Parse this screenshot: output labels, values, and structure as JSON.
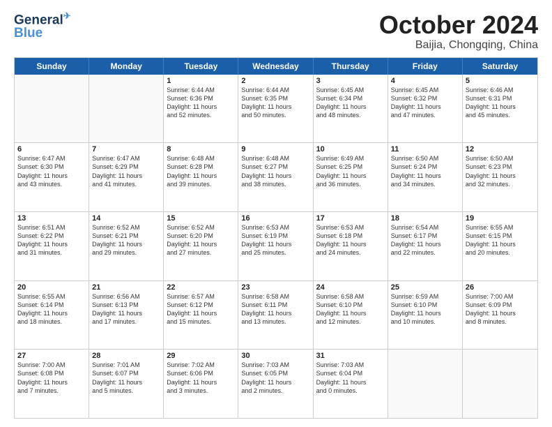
{
  "logo": {
    "line1": "General",
    "line2": "Blue"
  },
  "header": {
    "month": "October 2024",
    "location": "Baijia, Chongqing, China"
  },
  "weekdays": [
    "Sunday",
    "Monday",
    "Tuesday",
    "Wednesday",
    "Thursday",
    "Friday",
    "Saturday"
  ],
  "weeks": [
    [
      {
        "day": "",
        "info": "",
        "empty": true
      },
      {
        "day": "",
        "info": "",
        "empty": true
      },
      {
        "day": "1",
        "info": "Sunrise: 6:44 AM\nSunset: 6:36 PM\nDaylight: 11 hours\nand 52 minutes."
      },
      {
        "day": "2",
        "info": "Sunrise: 6:44 AM\nSunset: 6:35 PM\nDaylight: 11 hours\nand 50 minutes."
      },
      {
        "day": "3",
        "info": "Sunrise: 6:45 AM\nSunset: 6:34 PM\nDaylight: 11 hours\nand 48 minutes."
      },
      {
        "day": "4",
        "info": "Sunrise: 6:45 AM\nSunset: 6:32 PM\nDaylight: 11 hours\nand 47 minutes."
      },
      {
        "day": "5",
        "info": "Sunrise: 6:46 AM\nSunset: 6:31 PM\nDaylight: 11 hours\nand 45 minutes."
      }
    ],
    [
      {
        "day": "6",
        "info": "Sunrise: 6:47 AM\nSunset: 6:30 PM\nDaylight: 11 hours\nand 43 minutes."
      },
      {
        "day": "7",
        "info": "Sunrise: 6:47 AM\nSunset: 6:29 PM\nDaylight: 11 hours\nand 41 minutes."
      },
      {
        "day": "8",
        "info": "Sunrise: 6:48 AM\nSunset: 6:28 PM\nDaylight: 11 hours\nand 39 minutes."
      },
      {
        "day": "9",
        "info": "Sunrise: 6:48 AM\nSunset: 6:27 PM\nDaylight: 11 hours\nand 38 minutes."
      },
      {
        "day": "10",
        "info": "Sunrise: 6:49 AM\nSunset: 6:25 PM\nDaylight: 11 hours\nand 36 minutes."
      },
      {
        "day": "11",
        "info": "Sunrise: 6:50 AM\nSunset: 6:24 PM\nDaylight: 11 hours\nand 34 minutes."
      },
      {
        "day": "12",
        "info": "Sunrise: 6:50 AM\nSunset: 6:23 PM\nDaylight: 11 hours\nand 32 minutes."
      }
    ],
    [
      {
        "day": "13",
        "info": "Sunrise: 6:51 AM\nSunset: 6:22 PM\nDaylight: 11 hours\nand 31 minutes."
      },
      {
        "day": "14",
        "info": "Sunrise: 6:52 AM\nSunset: 6:21 PM\nDaylight: 11 hours\nand 29 minutes."
      },
      {
        "day": "15",
        "info": "Sunrise: 6:52 AM\nSunset: 6:20 PM\nDaylight: 11 hours\nand 27 minutes."
      },
      {
        "day": "16",
        "info": "Sunrise: 6:53 AM\nSunset: 6:19 PM\nDaylight: 11 hours\nand 25 minutes."
      },
      {
        "day": "17",
        "info": "Sunrise: 6:53 AM\nSunset: 6:18 PM\nDaylight: 11 hours\nand 24 minutes."
      },
      {
        "day": "18",
        "info": "Sunrise: 6:54 AM\nSunset: 6:17 PM\nDaylight: 11 hours\nand 22 minutes."
      },
      {
        "day": "19",
        "info": "Sunrise: 6:55 AM\nSunset: 6:15 PM\nDaylight: 11 hours\nand 20 minutes."
      }
    ],
    [
      {
        "day": "20",
        "info": "Sunrise: 6:55 AM\nSunset: 6:14 PM\nDaylight: 11 hours\nand 18 minutes."
      },
      {
        "day": "21",
        "info": "Sunrise: 6:56 AM\nSunset: 6:13 PM\nDaylight: 11 hours\nand 17 minutes."
      },
      {
        "day": "22",
        "info": "Sunrise: 6:57 AM\nSunset: 6:12 PM\nDaylight: 11 hours\nand 15 minutes."
      },
      {
        "day": "23",
        "info": "Sunrise: 6:58 AM\nSunset: 6:11 PM\nDaylight: 11 hours\nand 13 minutes."
      },
      {
        "day": "24",
        "info": "Sunrise: 6:58 AM\nSunset: 6:10 PM\nDaylight: 11 hours\nand 12 minutes."
      },
      {
        "day": "25",
        "info": "Sunrise: 6:59 AM\nSunset: 6:10 PM\nDaylight: 11 hours\nand 10 minutes."
      },
      {
        "day": "26",
        "info": "Sunrise: 7:00 AM\nSunset: 6:09 PM\nDaylight: 11 hours\nand 8 minutes."
      }
    ],
    [
      {
        "day": "27",
        "info": "Sunrise: 7:00 AM\nSunset: 6:08 PM\nDaylight: 11 hours\nand 7 minutes."
      },
      {
        "day": "28",
        "info": "Sunrise: 7:01 AM\nSunset: 6:07 PM\nDaylight: 11 hours\nand 5 minutes."
      },
      {
        "day": "29",
        "info": "Sunrise: 7:02 AM\nSunset: 6:06 PM\nDaylight: 11 hours\nand 3 minutes."
      },
      {
        "day": "30",
        "info": "Sunrise: 7:03 AM\nSunset: 6:05 PM\nDaylight: 11 hours\nand 2 minutes."
      },
      {
        "day": "31",
        "info": "Sunrise: 7:03 AM\nSunset: 6:04 PM\nDaylight: 11 hours\nand 0 minutes."
      },
      {
        "day": "",
        "info": "",
        "empty": true
      },
      {
        "day": "",
        "info": "",
        "empty": true
      }
    ]
  ]
}
